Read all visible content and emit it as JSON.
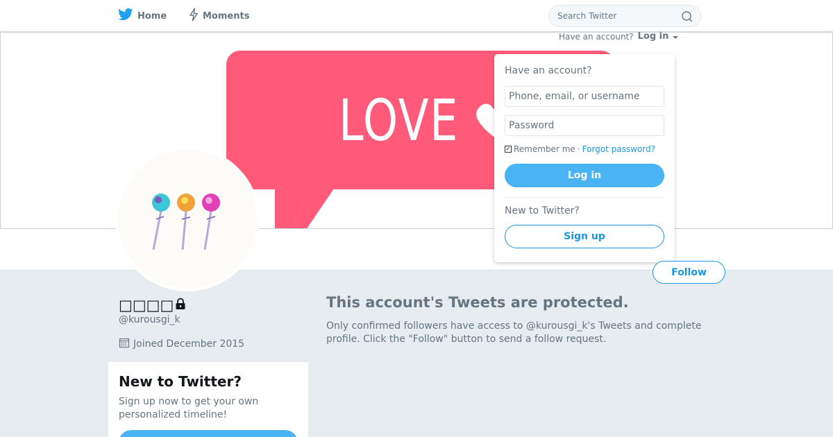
{
  "nav": {
    "home_label": "Home",
    "moments_label": "Moments"
  },
  "search": {
    "placeholder": "Search Twitter"
  },
  "banner": {
    "text": "LOVE"
  },
  "header_login": {
    "prompt": "Have an account?",
    "link_label": "Log in"
  },
  "login_dropdown": {
    "title": "Have an account?",
    "username_placeholder": "Phone, email, or username",
    "password_placeholder": "Password",
    "remember_label": "Remember me",
    "separator": "·",
    "forgot_label": "Forgot password?",
    "login_button": "Log in",
    "new_prompt": "New to Twitter?",
    "signup_button": "Sign up"
  },
  "profile": {
    "name": "□□□□",
    "handle": "@kurousgi_k",
    "joined": "Joined December 2015",
    "follow_button": "Follow"
  },
  "new_card": {
    "title": "New to Twitter?",
    "body": "Sign up now to get your own personalized timeline!"
  },
  "protected": {
    "title": "This account's Tweets are protected.",
    "body": "Only confirmed followers have access to @kurousgi_k's Tweets and complete profile. Click the \"Follow\" button to send a follow request."
  },
  "colors": {
    "brand": "#1da1f2",
    "button_blue": "#4ab3f4",
    "link_blue": "#1b95e0",
    "banner_pink": "#ff5a7a",
    "page_bg": "#e6ecf0"
  }
}
